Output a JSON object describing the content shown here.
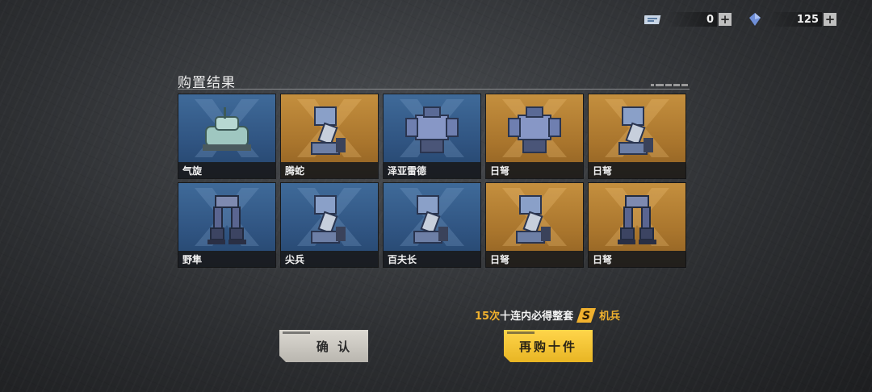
{
  "currency": {
    "ticket": {
      "icon": "ticket-icon",
      "value": "0"
    },
    "crystal": {
      "icon": "crystal-icon",
      "value": "125"
    },
    "plus": "+"
  },
  "panel": {
    "title": "购置结果"
  },
  "results": [
    {
      "name": "气旋",
      "rarity": "blue",
      "icon": "tank-mech-icon"
    },
    {
      "name": "腾蛇",
      "rarity": "gold",
      "icon": "mech-arm-icon"
    },
    {
      "name": "泽亚雷德",
      "rarity": "blue",
      "icon": "mech-torso-icon"
    },
    {
      "name": "日弩",
      "rarity": "gold",
      "icon": "mech-torso-icon"
    },
    {
      "name": "日弩",
      "rarity": "gold",
      "icon": "mech-arm-icon"
    },
    {
      "name": "野隼",
      "rarity": "blue",
      "icon": "mech-legs-icon"
    },
    {
      "name": "尖兵",
      "rarity": "blue",
      "icon": "mech-arm-icon"
    },
    {
      "name": "百夫长",
      "rarity": "blue",
      "icon": "mech-arm-icon"
    },
    {
      "name": "日弩",
      "rarity": "gold",
      "icon": "mech-arm-icon"
    },
    {
      "name": "日弩",
      "rarity": "gold",
      "icon": "mech-legs-icon"
    }
  ],
  "promo": {
    "count": "15次",
    "text": "十连内必得整套",
    "badge": "S",
    "suffix": "机兵"
  },
  "buttons": {
    "confirm": "确 认",
    "buy_again": "再购十件"
  },
  "colors": {
    "blue_card": "#2f5380",
    "gold_card": "#a8742c",
    "accent": "#f0b12e",
    "button_yellow": "#ffd54a"
  }
}
